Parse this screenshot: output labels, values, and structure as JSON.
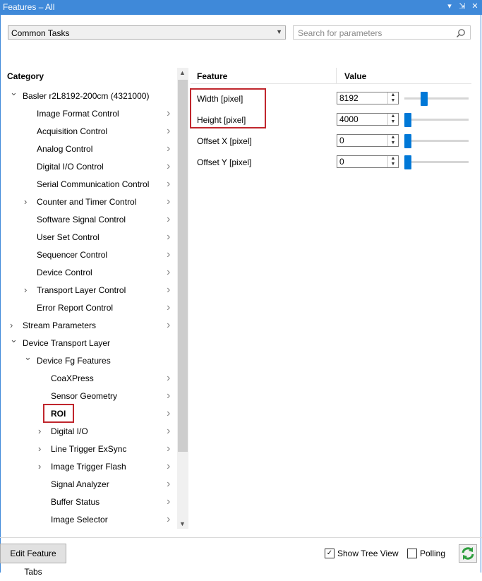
{
  "window": {
    "title": "Features – All",
    "controls": [
      "▾",
      "⇲",
      "✕"
    ]
  },
  "toolbar": {
    "combo_value": "Common Tasks",
    "search_placeholder": "Search for parameters"
  },
  "category": {
    "header": "Category",
    "items": [
      {
        "label": "Basler r2L8192-200cm (4321000)",
        "expander": "down",
        "level": 1,
        "chevron": false
      },
      {
        "label": "Image Format Control",
        "expander": "",
        "level": 2,
        "chevron": true
      },
      {
        "label": "Acquisition Control",
        "expander": "",
        "level": 2,
        "chevron": true
      },
      {
        "label": "Analog Control",
        "expander": "",
        "level": 2,
        "chevron": true
      },
      {
        "label": "Digital I/O Control",
        "expander": "",
        "level": 2,
        "chevron": true
      },
      {
        "label": "Serial Communication Control",
        "expander": "",
        "level": 2,
        "chevron": true
      },
      {
        "label": "Counter and Timer Control",
        "expander": "right",
        "level": 2,
        "chevron": true
      },
      {
        "label": "Software Signal Control",
        "expander": "",
        "level": 2,
        "chevron": true
      },
      {
        "label": "User Set Control",
        "expander": "",
        "level": 2,
        "chevron": true
      },
      {
        "label": "Sequencer Control",
        "expander": "",
        "level": 2,
        "chevron": true
      },
      {
        "label": "Device Control",
        "expander": "",
        "level": 2,
        "chevron": true
      },
      {
        "label": "Transport Layer Control",
        "expander": "right",
        "level": 2,
        "chevron": true
      },
      {
        "label": "Error Report Control",
        "expander": "",
        "level": 2,
        "chevron": true
      },
      {
        "label": "Stream Parameters",
        "expander": "right",
        "level": 1,
        "chevron": true
      },
      {
        "label": "Device Transport Layer",
        "expander": "down",
        "level": 1,
        "chevron": false
      },
      {
        "label": "Device Fg Features",
        "expander": "down",
        "level": 2,
        "chevron": false
      },
      {
        "label": "CoaXPress",
        "expander": "",
        "level": 3,
        "chevron": true
      },
      {
        "label": "Sensor Geometry",
        "expander": "",
        "level": 3,
        "chevron": true
      },
      {
        "label": "ROI",
        "expander": "",
        "level": 3,
        "chevron": true,
        "selected": true
      },
      {
        "label": "Digital I/O",
        "expander": "right",
        "level": 3,
        "chevron": true
      },
      {
        "label": "Line Trigger ExSync",
        "expander": "right",
        "level": 3,
        "chevron": true
      },
      {
        "label": "Image Trigger Flash",
        "expander": "right",
        "level": 3,
        "chevron": true
      },
      {
        "label": "Signal Analyzer",
        "expander": "",
        "level": 3,
        "chevron": true
      },
      {
        "label": "Buffer Status",
        "expander": "",
        "level": 3,
        "chevron": true
      },
      {
        "label": "Image Selector",
        "expander": "",
        "level": 3,
        "chevron": true
      }
    ]
  },
  "features": {
    "header_feature": "Feature",
    "header_value": "Value",
    "rows": [
      {
        "name": "Width [pixel]",
        "value": "8192",
        "slider_fraction": 0.28
      },
      {
        "name": "Height [pixel]",
        "value": "4000",
        "slider_fraction": 0.0
      },
      {
        "name": "Offset X [pixel]",
        "value": "0",
        "slider_fraction": 0.0
      },
      {
        "name": "Offset Y [pixel]",
        "value": "0",
        "slider_fraction": 0.0
      }
    ]
  },
  "bottom": {
    "edit_tabs_label": "Edit Feature Tabs",
    "show_tree_label": "Show Tree View",
    "show_tree_checked": true,
    "polling_label": "Polling",
    "polling_checked": false
  },
  "colors": {
    "accent": "#0078d7",
    "titlebar": "#3f89d9",
    "highlight": "#c0262d",
    "refresh_green": "#2e9e3e"
  }
}
